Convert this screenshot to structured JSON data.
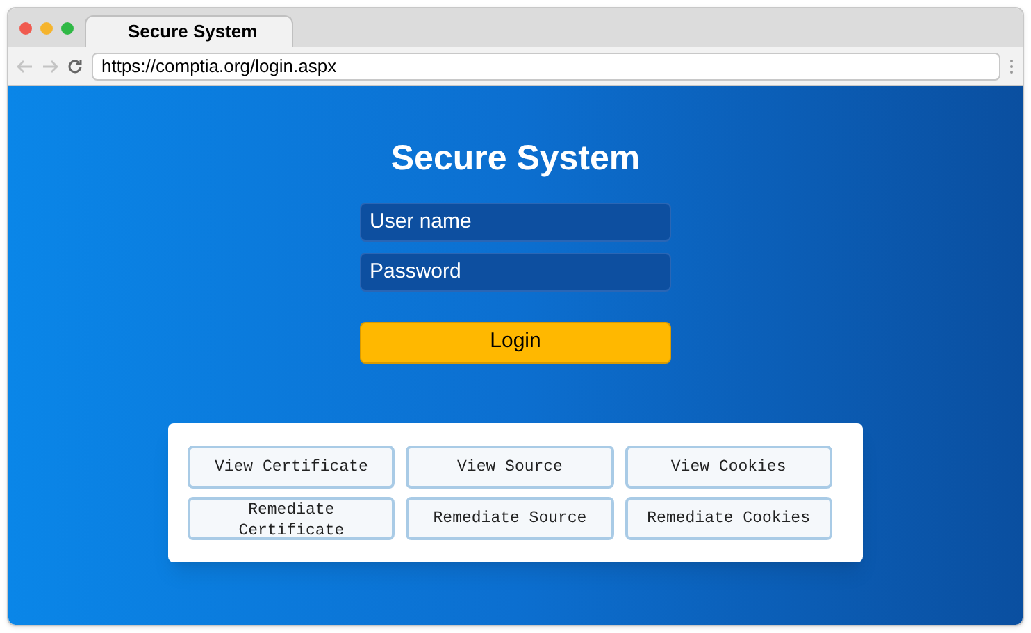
{
  "browser": {
    "tab_title": "Secure System",
    "url": "https://comptia.org/login.aspx"
  },
  "login": {
    "title": "Secure System",
    "username": {
      "placeholder": "User name"
    },
    "password": {
      "placeholder": "Password"
    },
    "button": "Login"
  },
  "actions": [
    {
      "label": "View Certificate"
    },
    {
      "label": "View Source"
    },
    {
      "label": "View Cookies"
    },
    {
      "label": "Remediate Certificate"
    },
    {
      "label": "Remediate Source"
    },
    {
      "label": "Remediate Cookies"
    }
  ]
}
